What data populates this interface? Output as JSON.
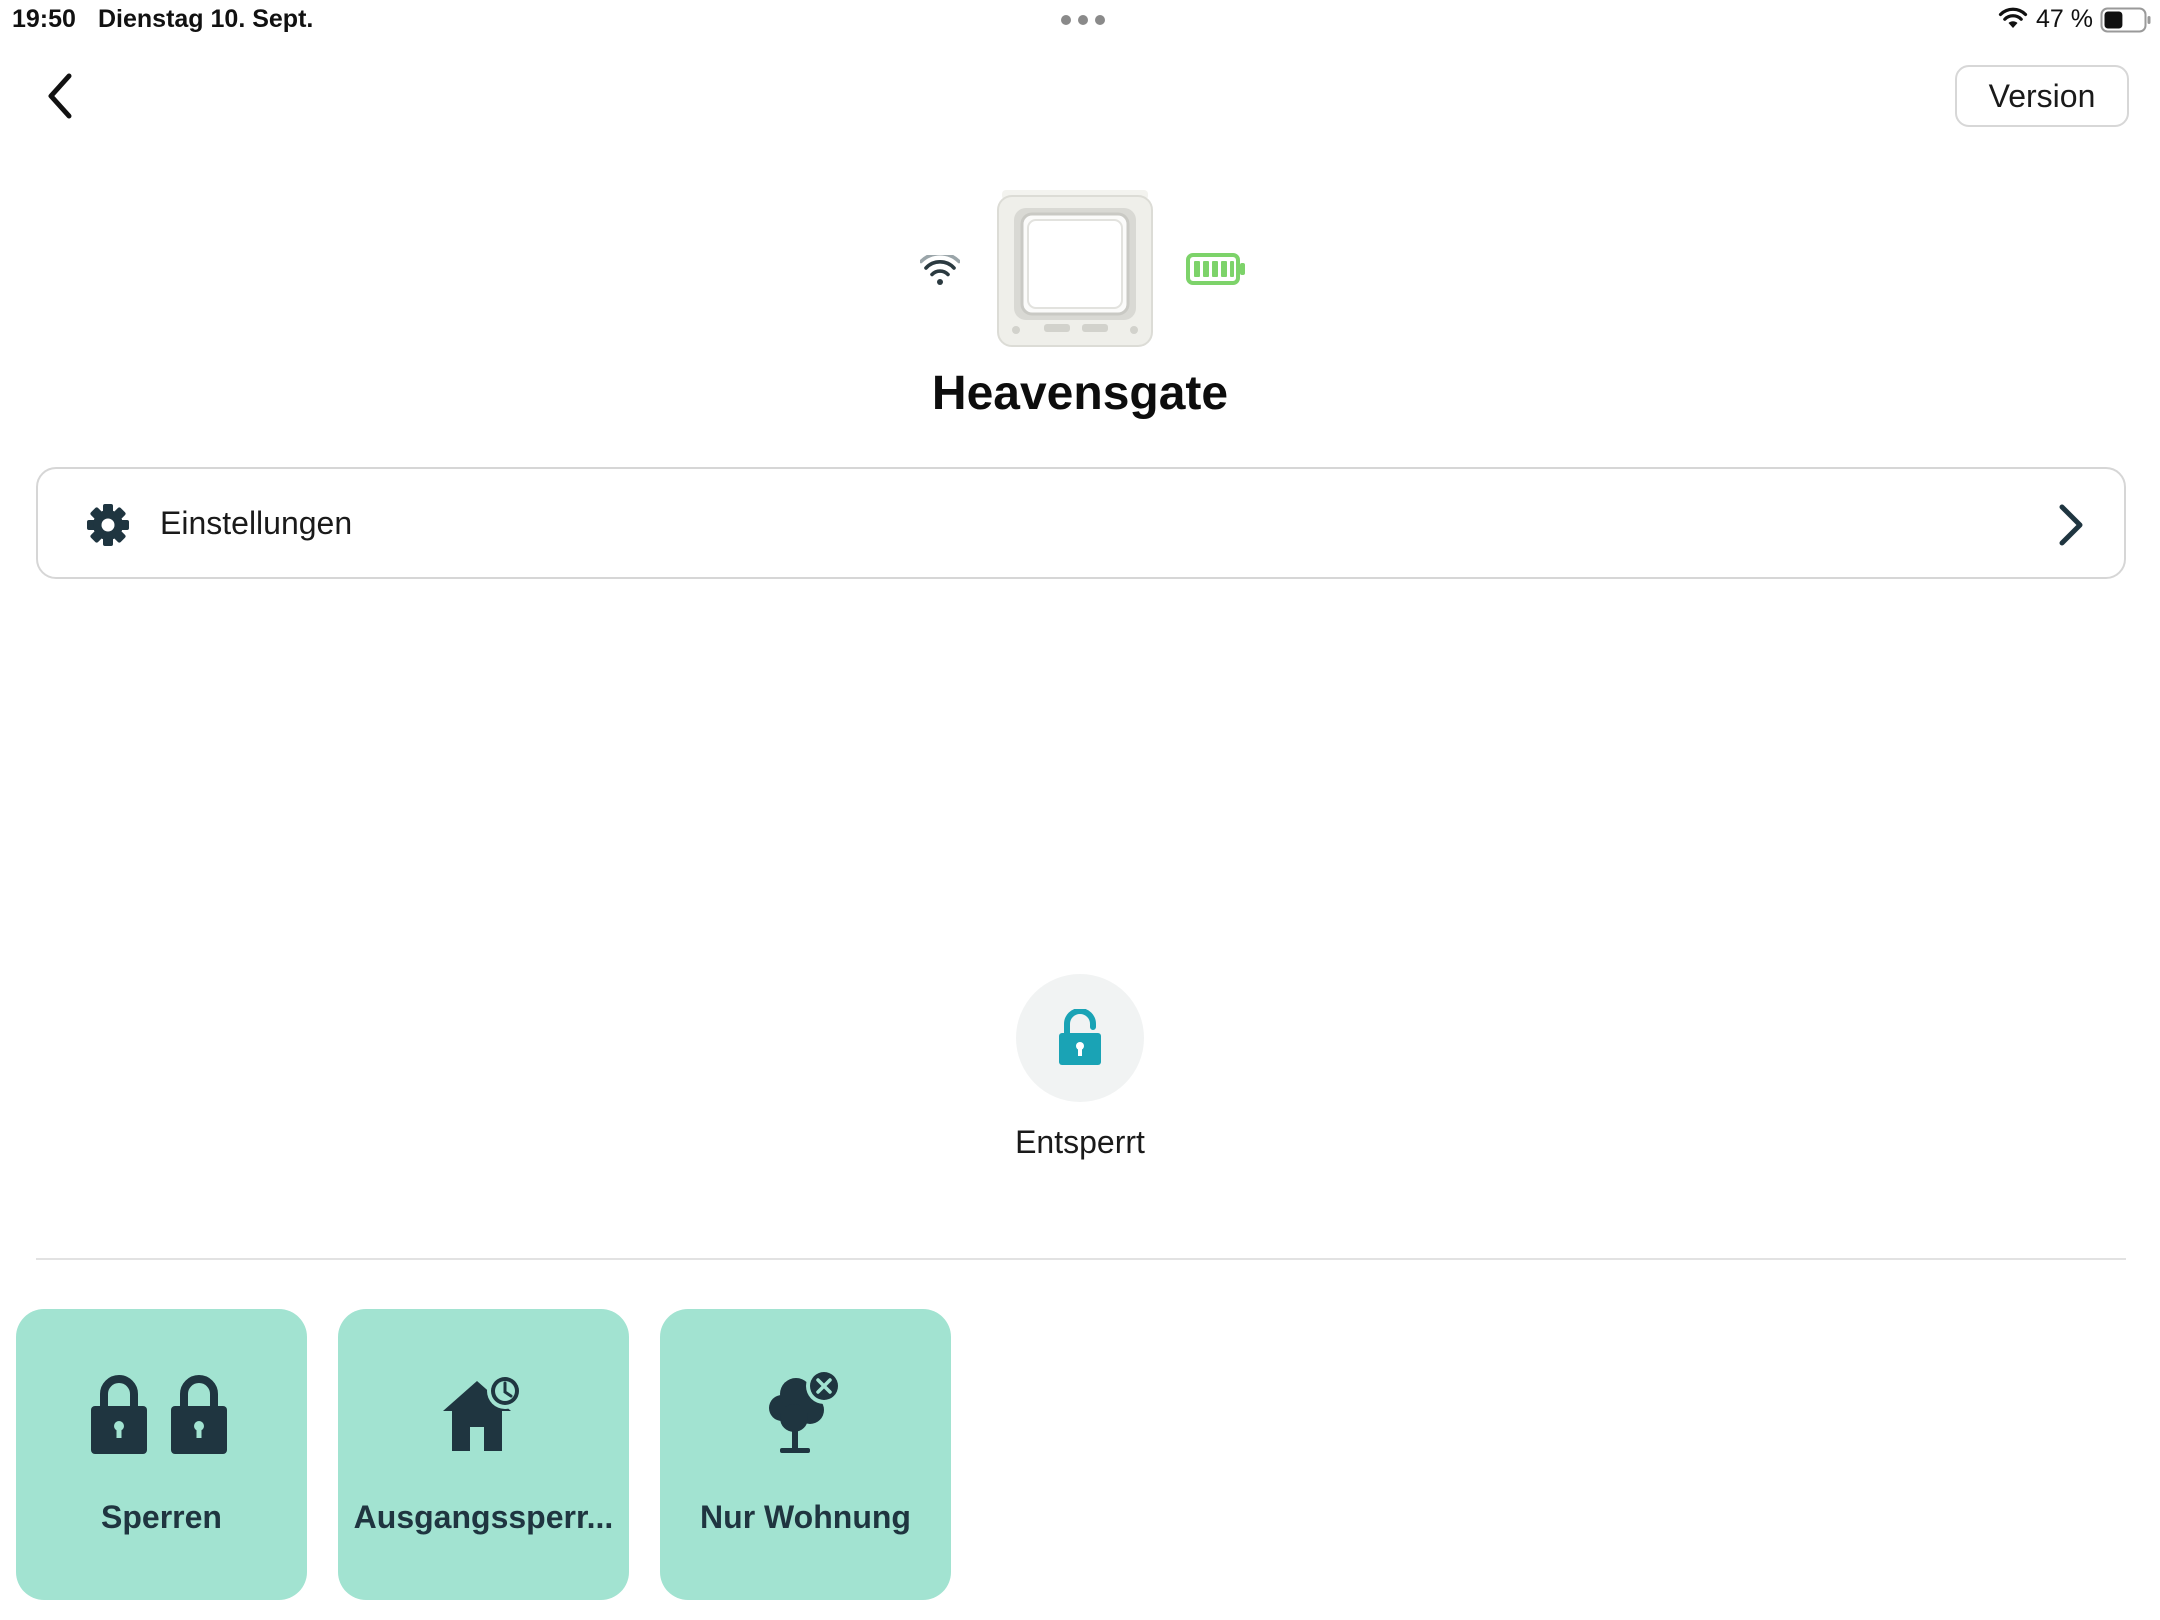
{
  "status_bar": {
    "time": "19:50",
    "date": "Dienstag 10. Sept.",
    "battery_percent": "47 %",
    "battery_level": 0.47,
    "icons": [
      "multitask-dots-icon",
      "wifi-icon",
      "battery-icon"
    ]
  },
  "nav": {
    "back_icon": "chevron-left-icon",
    "version_label": "Version"
  },
  "device": {
    "name": "Heavensgate",
    "connection_icon": "wifi-icon",
    "battery_icon": "battery-full-icon",
    "battery_level": 1.0,
    "battery_color": "#7dd36a"
  },
  "settings": {
    "label": "Einstellungen",
    "icon": "gear-icon",
    "chevron_icon": "chevron-right-icon"
  },
  "lock_status": {
    "label": "Entsperrt",
    "icon": "unlocked-padlock-icon",
    "icon_color": "#1aa3b5"
  },
  "modes": [
    {
      "label": "Sperren",
      "icon": "double-padlock-icon"
    },
    {
      "label": "Ausgangssperr...",
      "icon": "house-clock-icon"
    },
    {
      "label": "Nur Wohnung",
      "icon": "tree-x-icon"
    }
  ],
  "colors": {
    "tile_background": "#a2e3d1",
    "tile_text": "#1f3540",
    "icon_dark": "#1f3540"
  }
}
